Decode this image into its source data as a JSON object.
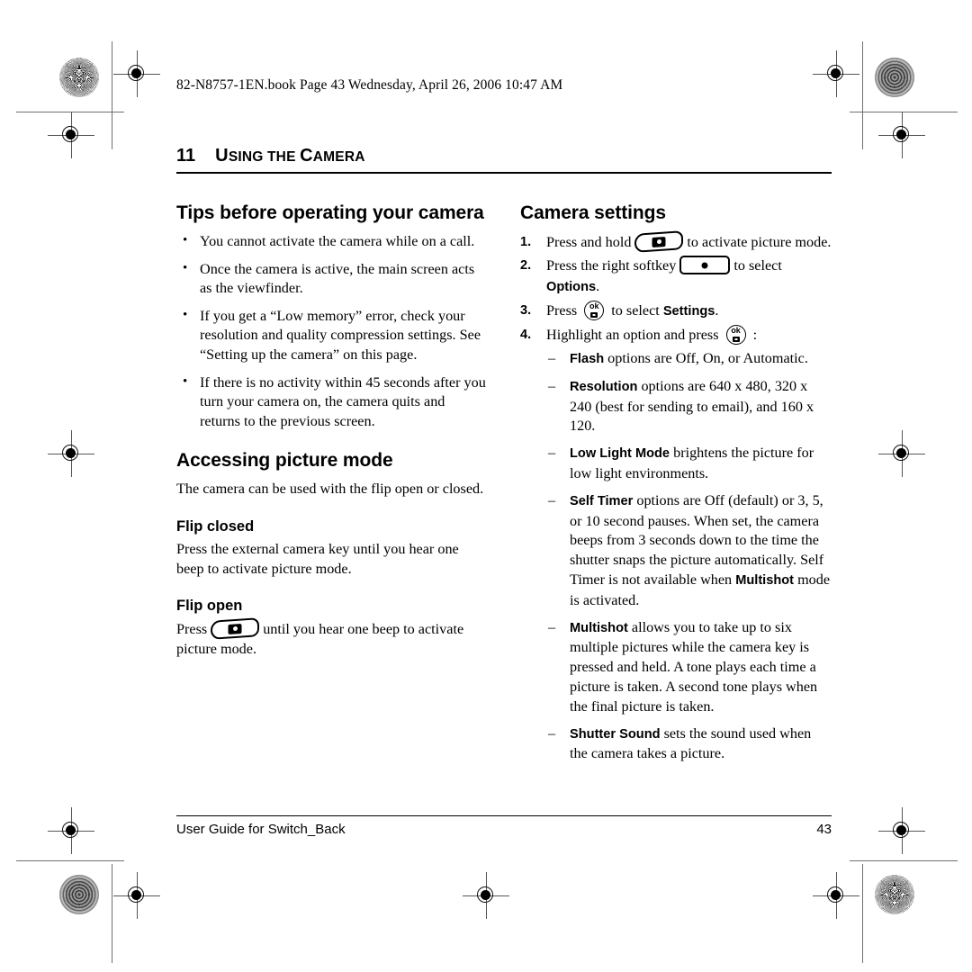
{
  "file_header": "82-N8757-1EN.book  Page 43  Wednesday, April 26, 2006  10:47 AM",
  "chapter": {
    "number": "11",
    "title_first": "U",
    "title_rest": "SING THE ",
    "title": "USING THE CAMERA"
  },
  "left_column": {
    "heading": "Tips before operating your camera",
    "bullets": [
      "You cannot activate the camera while on a call.",
      "Once the camera is active, the main screen acts as the viewfinder.",
      "If you get a “Low memory” error, check your resolution and quality compression settings. See “Setting up the camera” on this page.",
      "If there is no activity within 45 seconds after you turn your camera on, the camera quits and returns to the previous screen."
    ],
    "section2_heading": "Accessing picture mode",
    "section2_intro": "The camera can be used with the flip open or closed.",
    "flip_closed_heading": "Flip closed",
    "flip_closed_body": "Press the external camera key until you hear one beep to activate picture mode.",
    "flip_open_heading": "Flip open",
    "flip_open_pre": "Press",
    "flip_open_post": "until you hear one beep to activate picture mode."
  },
  "right_column": {
    "heading": "Camera settings",
    "steps": [
      {
        "num": "1.",
        "pre": "Press and hold",
        "icon": "camera-key-icon",
        "post": "to activate picture mode."
      },
      {
        "num": "2.",
        "pre": "Press the right softkey",
        "icon": "softkey-icon",
        "post": "to select",
        "keyword": "Options",
        "tail": "."
      },
      {
        "num": "3.",
        "pre": "Press",
        "icon": "ok-key-icon",
        "post": "to select",
        "keyword": "Settings",
        "tail": "."
      },
      {
        "num": "4.",
        "pre": "Highlight an option and press",
        "icon": "ok-key-icon",
        "post": ":"
      }
    ],
    "options": [
      {
        "keyword": "Flash",
        "text": " options are Off, On, or Automatic."
      },
      {
        "keyword": "Resolution",
        "text": " options are 640 x 480, 320 x 240 (best for sending to email), and 160 x 120."
      },
      {
        "keyword": "Low Light Mode",
        "text": " brightens the picture for low light environments."
      },
      {
        "keyword": "Self Timer",
        "text": " options are Off (default) or 3, 5, or 10 second pauses. When set, the camera beeps from 3 seconds down to the time the shutter snaps the picture automatically. Self Timer is not available when ",
        "keyword2": "Multishot",
        "text2": " mode is activated."
      },
      {
        "keyword": "Multishot",
        "text": " allows you to take up to six multiple pictures while the camera key is pressed and held. A tone plays each time a picture is taken. A second tone plays when the final picture is taken."
      },
      {
        "keyword": "Shutter Sound",
        "text": " sets the sound used when the camera takes a picture."
      }
    ]
  },
  "footer": {
    "guide": "User Guide for Switch_Back",
    "page": "43"
  },
  "icons": {
    "camera_key": "camera-key-icon",
    "softkey": "softkey-icon",
    "ok_key": "ok-key-icon",
    "registration": "registration-target-icon",
    "rosette": "color-rosette-icon"
  },
  "colors": {
    "ink": "#000000",
    "paper": "#ffffff",
    "mark_gray": "#6f6f6f"
  }
}
